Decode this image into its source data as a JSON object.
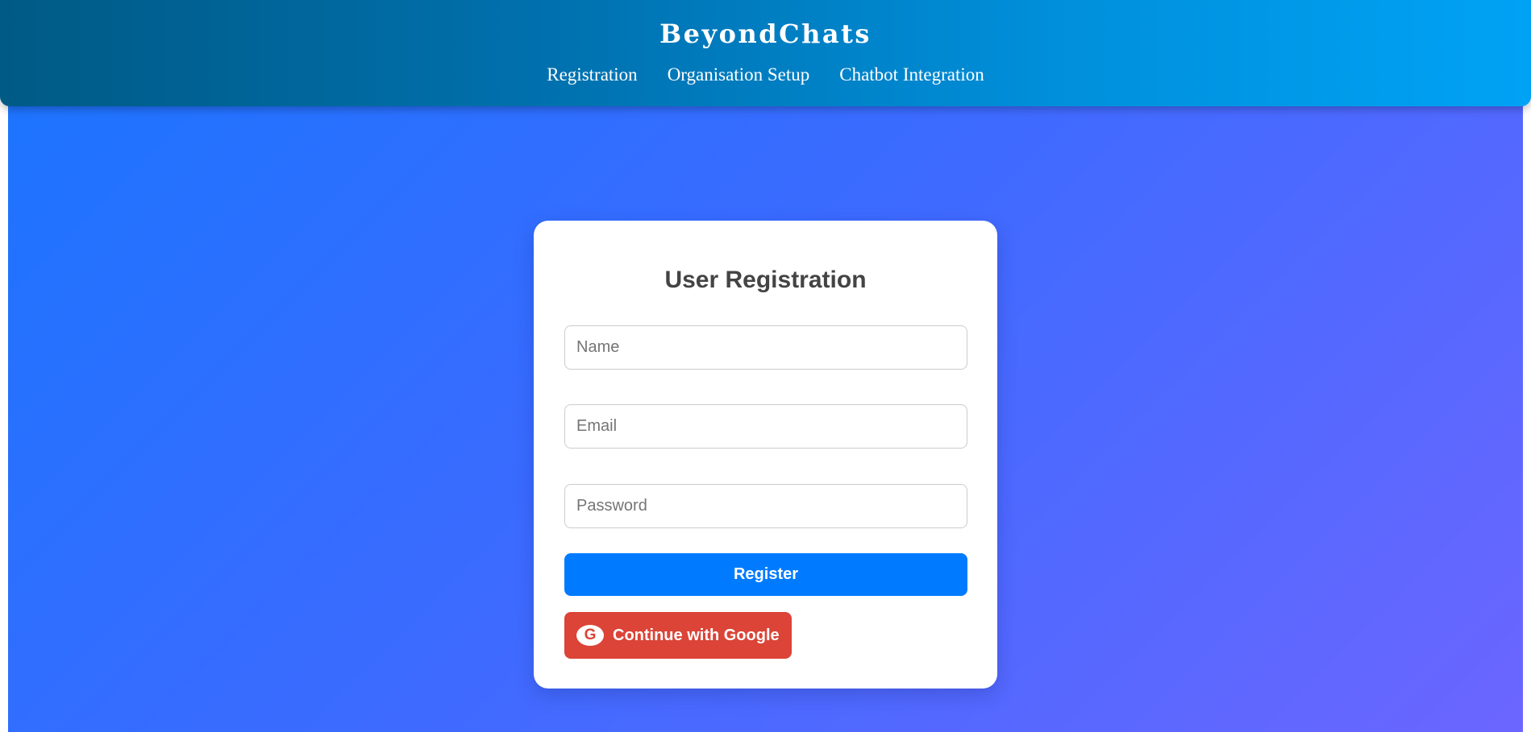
{
  "header": {
    "brand": "BeyondChats",
    "nav": [
      {
        "label": "Registration"
      },
      {
        "label": "Organisation Setup"
      },
      {
        "label": "Chatbot Integration"
      }
    ]
  },
  "form": {
    "title": "User Registration",
    "name_placeholder": "Name",
    "email_placeholder": "Email",
    "password_placeholder": "Password",
    "register_label": "Register",
    "google_label": "Continue with Google",
    "google_icon": "G"
  },
  "colors": {
    "register_button": "#007bff",
    "google_button": "#db4437",
    "header_gradient_start": "#005a85",
    "header_gradient_end": "#00a2f5",
    "background_gradient_start": "#1a75ff",
    "background_gradient_end": "#6b66ff"
  }
}
